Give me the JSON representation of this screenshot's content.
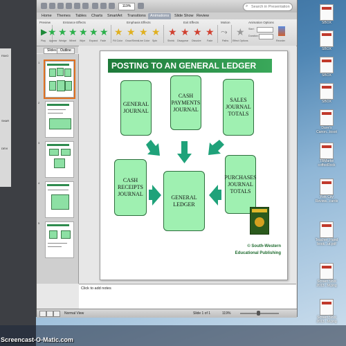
{
  "app": {
    "zoom": "119%",
    "search_placeholder": "Search in Presentation",
    "ribbon_tabs": [
      "Home",
      "Themes",
      "Tables",
      "Charts",
      "SmartArt",
      "Transitions",
      "Animations",
      "Slide Show",
      "Review"
    ],
    "active_tab": "Animations",
    "ribbon_groups": [
      "Preview",
      "Entrance Effects",
      "Emphasis Effects",
      "Exit Effects",
      "Motion",
      "Animation Options"
    ],
    "entrance_effects": [
      "Appear",
      "Wedge",
      "Wheel",
      "Wipe",
      "Expand",
      "Fade"
    ],
    "emphasis_effects": [
      "Fill Color",
      "Grow/Shrink",
      "Line Color",
      "Spin"
    ],
    "exit_effects": [
      "Shrink",
      "Disappear",
      "Dissolve",
      "Fade"
    ],
    "motion_label": "Paths",
    "effect_options_label": "Effect Options",
    "start_label": "Start:",
    "duration_label": "Duration:",
    "reorder_label": "Reorder",
    "play_label": "Play",
    "sidebar_tabs": [
      "Slides",
      "Outline"
    ],
    "active_sidebar_tab": "Slides",
    "slide_numbers": [
      "1",
      "2",
      "3",
      "4",
      "5"
    ],
    "notes_placeholder": "Click to add notes",
    "status_view": "Normal View",
    "status_slide": "Slide 1 of 1",
    "status_zoom": "119%"
  },
  "slide": {
    "title": "POSTING TO AN GENERAL LEDGER",
    "boxes": {
      "general_journal": "GENERAL\nJOURNAL",
      "cash_payments": "CASH\nPAYMENTS\nJOURNAL",
      "sales_totals": "SALES\nJOURNAL\nTOTALS",
      "cash_receipts": "CASH\nRECEIPTS\nJOURNAL",
      "general_ledger": "GENERAL\nLEDGER",
      "purchases_totals": "PURCHASES\nJOURNAL\nTOTALS"
    },
    "credit_line1": "© South-Western",
    "credit_line2": "Educational Publishing",
    "accent_green": "#2e8b4e",
    "box_fill": "#9ff0b1",
    "arrow_color": "#1fa27a"
  },
  "desktop": {
    "icons": [
      "SBOX",
      "SBOX",
      "SBOX",
      "SBOX",
      "SBOX",
      "SBOX"
    ],
    "files": [
      "Dave's\nCanon...tosot",
      "TBMarke\ncoffeeRock",
      "York City\nReview...cards",
      "Teacher_Hand\nbook...ut.pdf",
      "Screen Shot\n2013...M.png",
      "Screen Shot\n2013...M.png"
    ],
    "left_labels": [
      "FAVO",
      "SHAR",
      "DEVI"
    ]
  },
  "watermark": "Screencast-O-Matic.com"
}
